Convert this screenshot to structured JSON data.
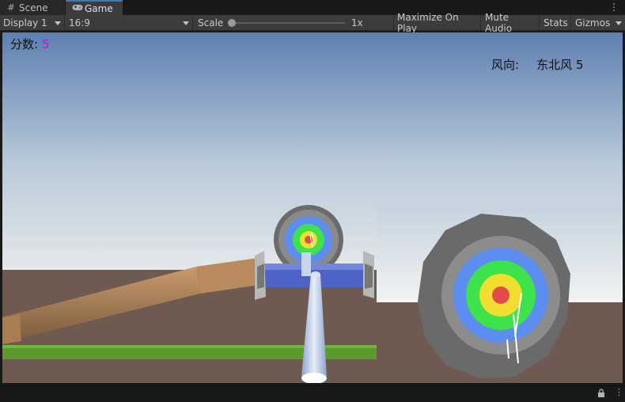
{
  "tabs": [
    {
      "label": "Scene",
      "icon": "grid-icon"
    },
    {
      "label": "Game",
      "icon": "gamepad-icon"
    }
  ],
  "toolbar": {
    "display": "Display 1",
    "aspect": "16:9",
    "scale_label": "Scale",
    "scale_value": "1x",
    "scale_fraction": 0.0,
    "maximize": "Maximize On Play",
    "mute": "Mute Audio",
    "stats": "Stats",
    "gizmos": "Gizmos"
  },
  "hud": {
    "score_label": "分数:",
    "score_value": "5",
    "wind_label": "风向:",
    "wind_value": "东北风 5"
  },
  "colors": {
    "score_value": "#b21ec4",
    "sky_top": "#5d7fb0",
    "sky_bottom": "#d6dfe6",
    "ground": "#6e5a50",
    "grass": "#5b9a2c",
    "target_outer": "#6a6a6a",
    "ring_blue": "#5b8ef0",
    "ring_green": "#3ee24a",
    "ring_yellow": "#f2de2e",
    "bullseye": "#e24c4c"
  }
}
